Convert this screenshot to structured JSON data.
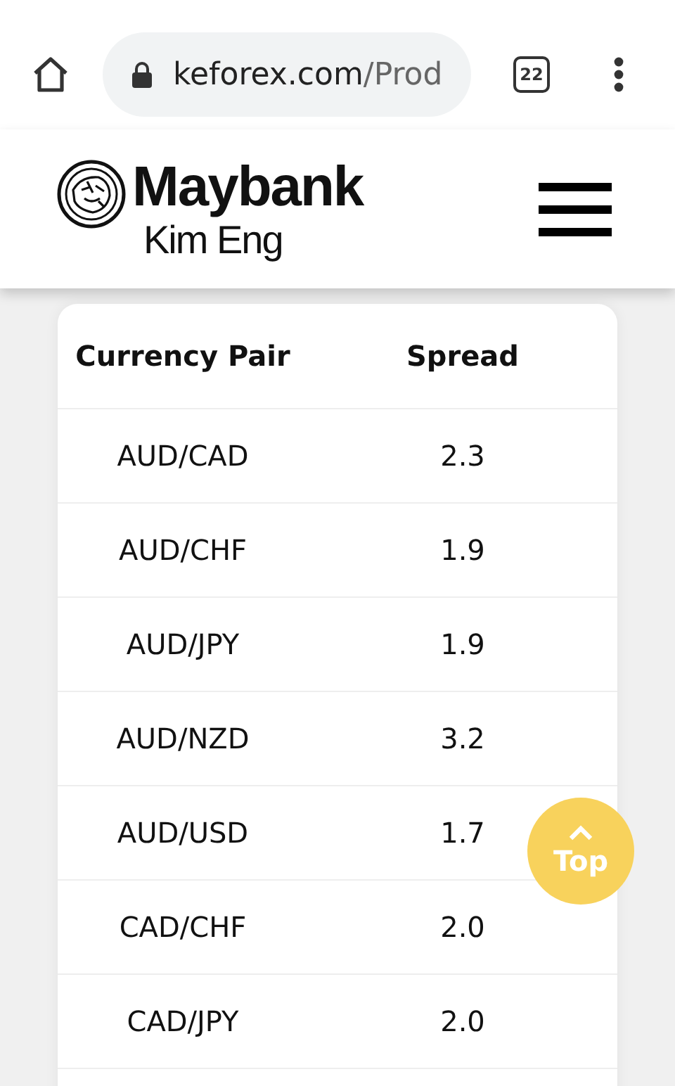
{
  "browser": {
    "url_domain": "keforex.com",
    "url_path": "/Prod",
    "tab_count": "22"
  },
  "header": {
    "brand": "Maybank",
    "sub_brand": "Kim Eng"
  },
  "table": {
    "columns": [
      "Currency Pair",
      "Spread"
    ],
    "rows": [
      {
        "pair": "AUD/CAD",
        "spread": "2.3"
      },
      {
        "pair": "AUD/CHF",
        "spread": "1.9"
      },
      {
        "pair": "AUD/JPY",
        "spread": "1.9"
      },
      {
        "pair": "AUD/NZD",
        "spread": "3.2"
      },
      {
        "pair": "AUD/USD",
        "spread": "1.7"
      },
      {
        "pair": "CAD/CHF",
        "spread": "2.0"
      },
      {
        "pair": "CAD/JPY",
        "spread": "2.0"
      }
    ]
  },
  "top_button": {
    "label": "Top"
  }
}
